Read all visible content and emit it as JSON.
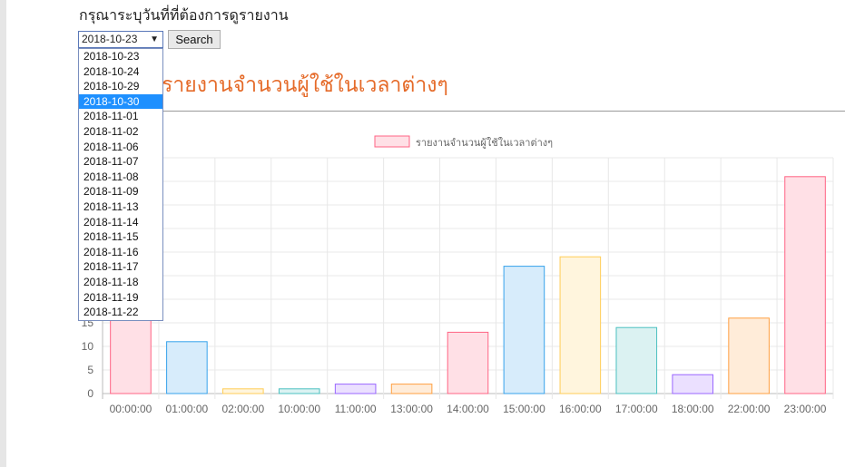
{
  "header": {
    "prompt": "กรุณาระบุวันที่ที่ต้องการดูรายงาน",
    "selected_date": "2018-10-23",
    "search_label": "Search",
    "report_title": "รายงานจำนวนผู้ใช้ในเวลาต่างๆ"
  },
  "dropdown": {
    "options": [
      "2018-10-23",
      "2018-10-24",
      "2018-10-29",
      "2018-10-30",
      "2018-11-01",
      "2018-11-02",
      "2018-11-06",
      "2018-11-07",
      "2018-11-08",
      "2018-11-09",
      "2018-11-13",
      "2018-11-14",
      "2018-11-15",
      "2018-11-16",
      "2018-11-17",
      "2018-11-18",
      "2018-11-19",
      "2018-11-22"
    ],
    "highlighted": "2018-10-30"
  },
  "chart_data": {
    "type": "bar",
    "legend": "รายงานจำนวนผู้ใช้ในเวลาต่างๆ",
    "categories": [
      "00:00:00",
      "01:00:00",
      "02:00:00",
      "10:00:00",
      "11:00:00",
      "13:00:00",
      "14:00:00",
      "15:00:00",
      "16:00:00",
      "17:00:00",
      "18:00:00",
      "22:00:00",
      "23:00:00"
    ],
    "values": [
      16,
      11,
      1,
      1,
      2,
      2,
      13,
      27,
      29,
      14,
      4,
      16,
      46
    ],
    "y_ticks": [
      0,
      5,
      10,
      15
    ],
    "ylim": [
      0,
      50
    ],
    "grid": true,
    "legend_position": "top",
    "colors": [
      {
        "fill": "#ffe0e6",
        "stroke": "#ff6384"
      },
      {
        "fill": "#d7ecfb",
        "stroke": "#36a2eb"
      },
      {
        "fill": "#fff5dd",
        "stroke": "#ffcd56"
      },
      {
        "fill": "#dbf2f2",
        "stroke": "#4bc0c0"
      },
      {
        "fill": "#ebe0ff",
        "stroke": "#9966ff"
      },
      {
        "fill": "#ffecd9",
        "stroke": "#ff9f40"
      },
      {
        "fill": "#ffe0e6",
        "stroke": "#ff6384"
      },
      {
        "fill": "#d7ecfb",
        "stroke": "#36a2eb"
      },
      {
        "fill": "#fff5dd",
        "stroke": "#ffcd56"
      },
      {
        "fill": "#dbf2f2",
        "stroke": "#4bc0c0"
      },
      {
        "fill": "#ebe0ff",
        "stroke": "#9966ff"
      },
      {
        "fill": "#ffecd9",
        "stroke": "#ff9f40"
      },
      {
        "fill": "#ffe0e6",
        "stroke": "#ff6384"
      }
    ]
  }
}
